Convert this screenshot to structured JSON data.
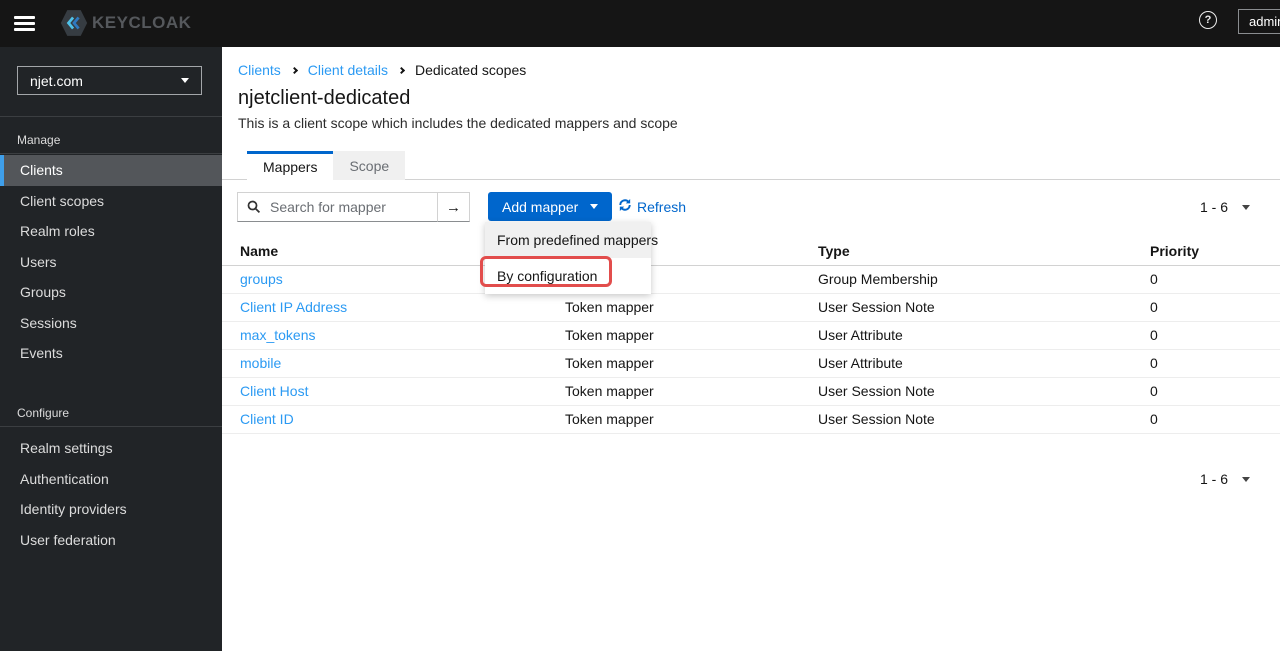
{
  "masthead": {
    "brand": "KEYCLOAK",
    "username": "admin",
    "help_glyph": "?"
  },
  "sidebar": {
    "realm": "njet.com",
    "sections": [
      {
        "label": "Manage",
        "items": [
          {
            "label": "Clients",
            "active": true
          },
          {
            "label": "Client scopes",
            "active": false
          },
          {
            "label": "Realm roles",
            "active": false
          },
          {
            "label": "Users",
            "active": false
          },
          {
            "label": "Groups",
            "active": false
          },
          {
            "label": "Sessions",
            "active": false
          },
          {
            "label": "Events",
            "active": false
          }
        ]
      },
      {
        "label": "Configure",
        "items": [
          {
            "label": "Realm settings",
            "active": false
          },
          {
            "label": "Authentication",
            "active": false
          },
          {
            "label": "Identity providers",
            "active": false
          },
          {
            "label": "User federation",
            "active": false
          }
        ]
      }
    ]
  },
  "breadcrumb": {
    "items": [
      {
        "label": "Clients"
      },
      {
        "label": "Client details"
      },
      {
        "label": "Dedicated scopes"
      }
    ]
  },
  "page": {
    "title": "njetclient-dedicated",
    "subtitle": "This is a client scope which includes the dedicated mappers and scope"
  },
  "tabs": [
    {
      "label": "Mappers",
      "active": true
    },
    {
      "label": "Scope",
      "active": false
    }
  ],
  "toolbar": {
    "search_placeholder": "Search for mapper",
    "arrow_glyph": "→",
    "add_mapper_label": "Add mapper",
    "refresh_label": "Refresh"
  },
  "dropdown": {
    "items": [
      {
        "label": "From predefined mappers",
        "annotated": false
      },
      {
        "label": "By configuration",
        "annotated": true
      }
    ]
  },
  "table": {
    "headers": {
      "name": "Name",
      "category": "",
      "type": "Type",
      "priority": "Priority"
    },
    "rows": [
      {
        "name": "groups",
        "category": "",
        "type": "Group Membership",
        "priority": "0"
      },
      {
        "name": "Client IP Address",
        "category": "Token mapper",
        "type": "User Session Note",
        "priority": "0"
      },
      {
        "name": "max_tokens",
        "category": "Token mapper",
        "type": "User Attribute",
        "priority": "0"
      },
      {
        "name": "mobile",
        "category": "Token mapper",
        "type": "User Attribute",
        "priority": "0"
      },
      {
        "name": "Client Host",
        "category": "Token mapper",
        "type": "User Session Note",
        "priority": "0"
      },
      {
        "name": "Client ID",
        "category": "Token mapper",
        "type": "User Session Note",
        "priority": "0"
      }
    ]
  },
  "pagination": {
    "top": "1 - 6",
    "bottom": "1 - 6"
  },
  "colors": {
    "accent": "#0066cc",
    "table_link": "#2b9af3",
    "annotation_red": "#e24d4c",
    "masthead_bg": "#151515",
    "sidebar_bg": "#212427",
    "active_nav_bg": "#53565a",
    "active_nav_border": "#3f9fea"
  }
}
